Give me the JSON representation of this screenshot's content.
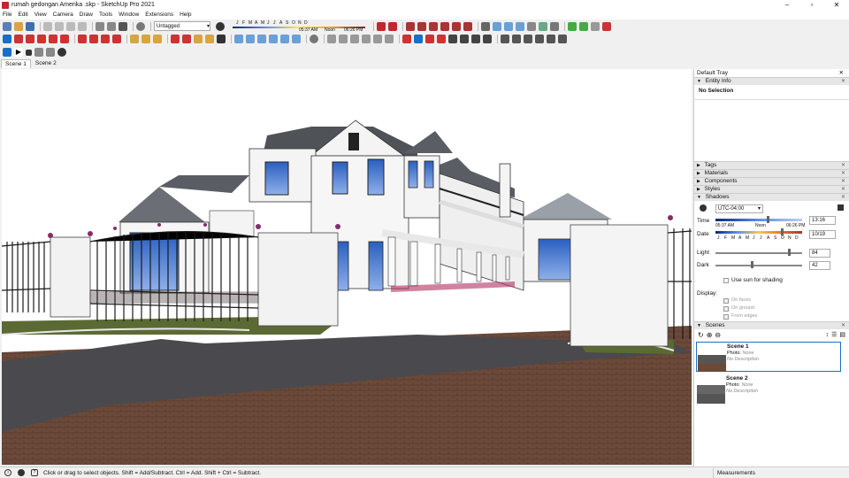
{
  "window": {
    "title": "rumah gedongan Amerika .skp - SketchUp Pro 2021",
    "minimize": "–",
    "maximize": "▫",
    "close": "✕"
  },
  "menu": [
    "File",
    "Edit",
    "View",
    "Camera",
    "Draw",
    "Tools",
    "Window",
    "Extensions",
    "Help"
  ],
  "toolbar": {
    "tag_value": "Untagged",
    "months": [
      "J",
      "F",
      "M",
      "A",
      "M",
      "J",
      "J",
      "A",
      "S",
      "O",
      "N",
      "D"
    ],
    "time_start": "05:37 AM",
    "time_noon": "Noon",
    "time_end": "06:26 PM"
  },
  "scene_tabs": [
    "Scene 1",
    "Scene 2"
  ],
  "tray": {
    "title": "Default Tray",
    "entity_info": {
      "label": "Entity Info",
      "selection": "No Selection"
    },
    "panels": [
      "Tags",
      "Materials",
      "Components",
      "Styles"
    ],
    "shadows": {
      "label": "Shadows",
      "timezone": "UTC-04:00",
      "time_label": "Time",
      "time_start": "05:37 AM",
      "time_noon": "Noon",
      "time_end": "06:26 PM",
      "time_value": "13:16",
      "date_label": "Date",
      "months": [
        "J",
        "F",
        "M",
        "A",
        "M",
        "J",
        "J",
        "A",
        "S",
        "O",
        "N",
        "D"
      ],
      "date_value": "10/19",
      "light_label": "Light",
      "light_value": "84",
      "dark_label": "Dark",
      "dark_value": "42",
      "use_sun": "Use sun for shading",
      "display_label": "Display:",
      "on_faces": "On faces",
      "on_ground": "On ground",
      "from_edges": "From edges"
    },
    "scenes": {
      "label": "Scenes",
      "items": [
        {
          "name": "Scene 1",
          "photo": "Photo: ",
          "photo_val": "None",
          "desc": "No Description"
        },
        {
          "name": "Scene 2",
          "photo": "Photo: ",
          "photo_val": "None",
          "desc": "No Description"
        }
      ]
    }
  },
  "status": {
    "message": "Click or drag to select objects. Shift = Add/Subtract. Ctrl = Add. Shift + Ctrl = Subtract.",
    "measurements_label": "Measurements"
  },
  "colors": {
    "sketchup_red": "#c0282d",
    "selection_blue": "#1a6fc4",
    "panel_gray": "#e6e6e6"
  }
}
